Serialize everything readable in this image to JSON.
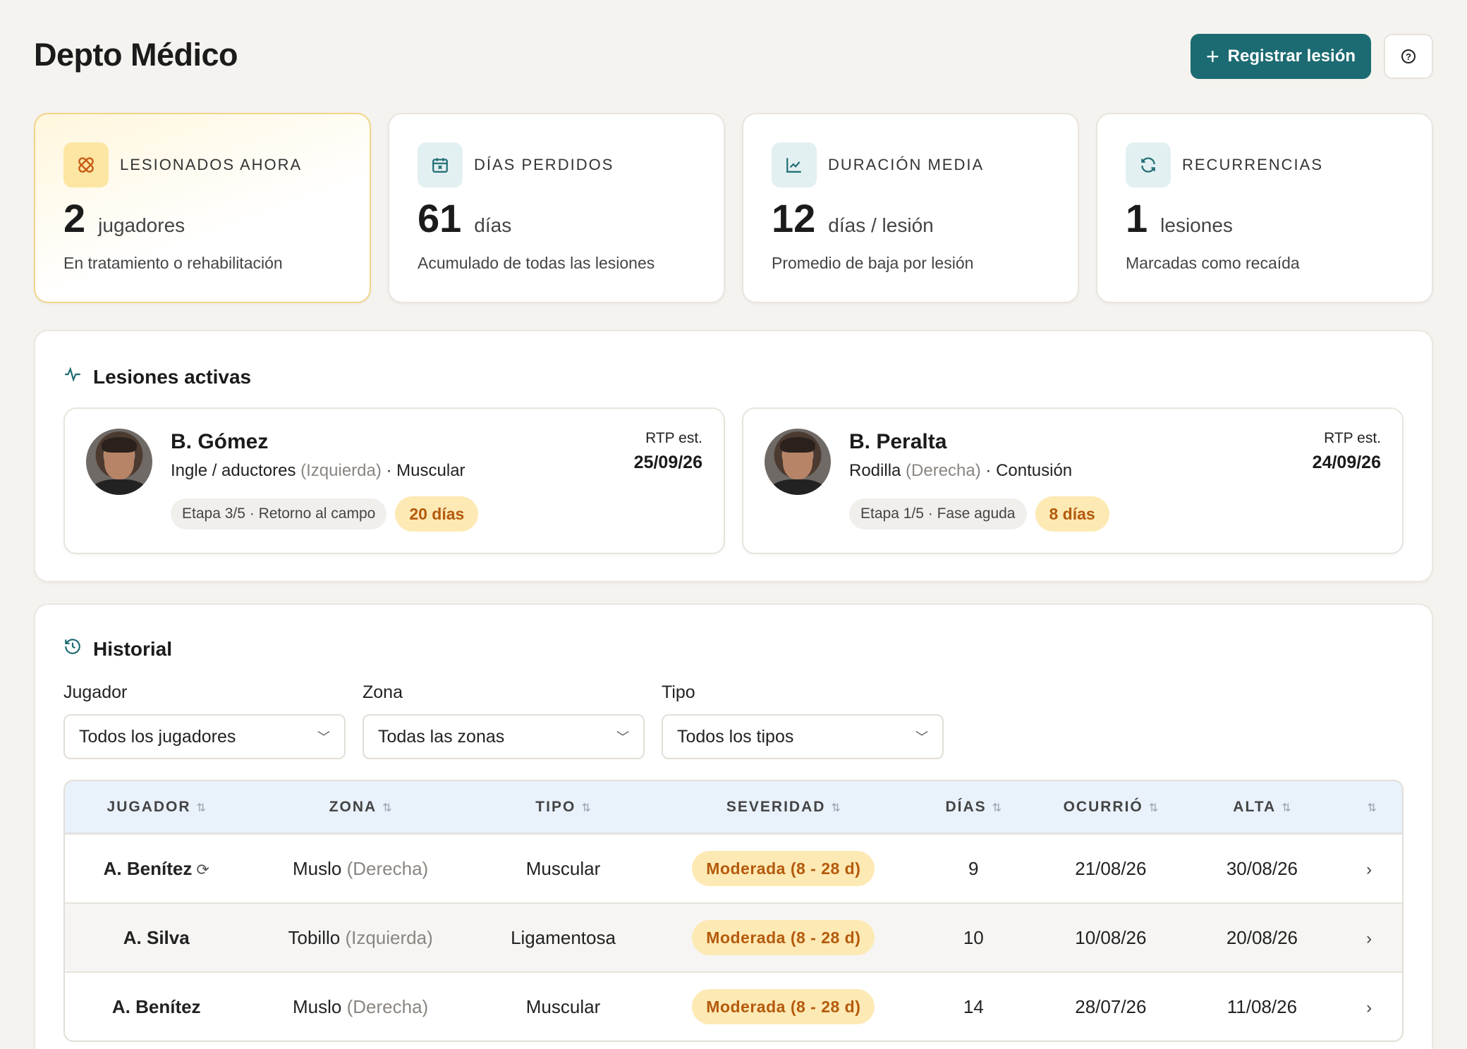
{
  "header": {
    "title": "Depto Médico",
    "register_label": "Registrar lesión",
    "help_icon": "help-icon"
  },
  "stats": [
    {
      "label": "LESIONADOS AHORA",
      "value": "2",
      "unit": "jugadores",
      "sub": "En tratamiento o rehabilitación",
      "icon": "bandage-icon",
      "highlight": true
    },
    {
      "label": "DÍAS PERDIDOS",
      "value": "61",
      "unit": "días",
      "sub": "Acumulado de todas las lesiones",
      "icon": "calendar-x-icon"
    },
    {
      "label": "DURACIÓN MEDIA",
      "value": "12",
      "unit": "días / lesión",
      "sub": "Promedio de baja por lesión",
      "icon": "trend-chart-icon"
    },
    {
      "label": "RECURRENCIAS",
      "value": "1",
      "unit": "lesiones",
      "sub": "Marcadas como recaída",
      "icon": "refresh-icon"
    }
  ],
  "active": {
    "title": "Lesiones activas",
    "rtp_label": "RTP est.",
    "cards": [
      {
        "name": "B. Gómez",
        "zone": "Ingle / aductores",
        "side": "(Izquierda)",
        "type": "· Muscular",
        "stage": "Etapa 3/5 · Retorno al campo",
        "days": "20 días",
        "rtp": "25/09/26"
      },
      {
        "name": "B. Peralta",
        "zone": "Rodilla",
        "side": "(Derecha)",
        "type": "· Contusión",
        "stage": "Etapa 1/5 · Fase aguda",
        "days": "8 días",
        "rtp": "24/09/26"
      }
    ]
  },
  "history": {
    "title": "Historial",
    "filters": [
      {
        "label": "Jugador",
        "value": "Todos los jugadores"
      },
      {
        "label": "Zona",
        "value": "Todas las zonas"
      },
      {
        "label": "Tipo",
        "value": "Todos los tipos"
      }
    ],
    "columns": [
      "JUGADOR",
      "ZONA",
      "TIPO",
      "SEVERIDAD",
      "DÍAS",
      "OCURRIÓ",
      "ALTA"
    ],
    "sort_glyph": "⇅",
    "rows": [
      {
        "player": "A. Benítez",
        "recurrence_icon": "⟳",
        "zone": "Muslo",
        "side": "(Derecha)",
        "type": "Muscular",
        "severity": "Moderada (8 - 28 d)",
        "days": "9",
        "occurred": "21/08/26",
        "discharge": "30/08/26"
      },
      {
        "player": "A. Silva",
        "recurrence_icon": "",
        "zone": "Tobillo",
        "side": "(Izquierda)",
        "type": "Ligamentosa",
        "severity": "Moderada (8 - 28 d)",
        "days": "10",
        "occurred": "10/08/26",
        "discharge": "20/08/26"
      },
      {
        "player": "A. Benítez",
        "recurrence_icon": "",
        "zone": "Muslo",
        "side": "(Derecha)",
        "type": "Muscular",
        "severity": "Moderada (8 - 28 d)",
        "days": "14",
        "occurred": "28/07/26",
        "discharge": "11/08/26"
      }
    ]
  },
  "colors": {
    "primary": "#1c6b72",
    "severity_bg": "#fde9b4",
    "severity_text": "#b45a0c",
    "highlight_border": "#f1d48a"
  }
}
